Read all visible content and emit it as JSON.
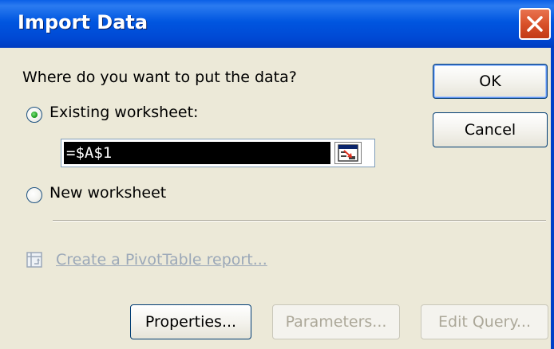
{
  "window": {
    "title": "Import Data",
    "close_icon": "close-icon"
  },
  "prompt": "Where do you want to put the data?",
  "options": {
    "existing": {
      "label": "Existing worksheet:",
      "selected": true
    },
    "reference": {
      "value": "=$A$1",
      "button_icon": "collapse-dialog-icon"
    },
    "new": {
      "label": "New worksheet",
      "selected": false
    }
  },
  "pivot": {
    "label": "Create a PivotTable report...",
    "icon": "pivot-table-icon",
    "enabled": false
  },
  "buttons": {
    "ok": "OK",
    "cancel": "Cancel",
    "properties": "Properties...",
    "parameters": "Parameters...",
    "edit_query": "Edit Query..."
  },
  "colors": {
    "title_bar": "#0055e5",
    "close_button": "#d9512a",
    "dialog_background": "#ece9d8",
    "radio_selected": "#21a121",
    "disabled_text": "#aca899"
  }
}
